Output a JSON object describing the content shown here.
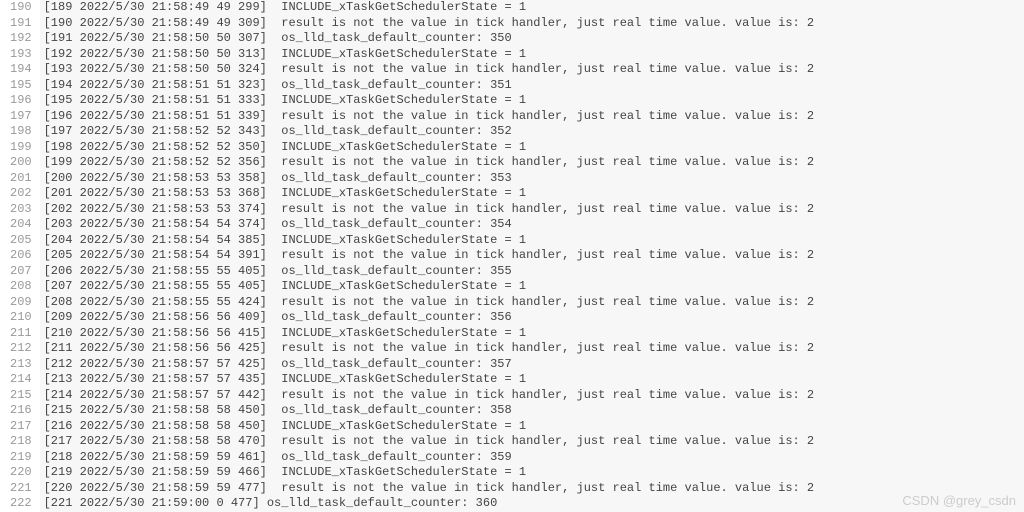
{
  "watermark": "CSDN @grey_csdn",
  "lines": [
    {
      "n": 190,
      "t": "[189 2022/5/30 21:58:49 49 299]  INCLUDE_xTaskGetSchedulerState = 1"
    },
    {
      "n": 191,
      "t": "[190 2022/5/30 21:58:49 49 309]  result is not the value in tick handler, just real time value. value is: 2"
    },
    {
      "n": 192,
      "t": "[191 2022/5/30 21:58:50 50 307]  os_lld_task_default_counter: 350"
    },
    {
      "n": 193,
      "t": "[192 2022/5/30 21:58:50 50 313]  INCLUDE_xTaskGetSchedulerState = 1"
    },
    {
      "n": 194,
      "t": "[193 2022/5/30 21:58:50 50 324]  result is not the value in tick handler, just real time value. value is: 2"
    },
    {
      "n": 195,
      "t": "[194 2022/5/30 21:58:51 51 323]  os_lld_task_default_counter: 351"
    },
    {
      "n": 196,
      "t": "[195 2022/5/30 21:58:51 51 333]  INCLUDE_xTaskGetSchedulerState = 1"
    },
    {
      "n": 197,
      "t": "[196 2022/5/30 21:58:51 51 339]  result is not the value in tick handler, just real time value. value is: 2"
    },
    {
      "n": 198,
      "t": "[197 2022/5/30 21:58:52 52 343]  os_lld_task_default_counter: 352"
    },
    {
      "n": 199,
      "t": "[198 2022/5/30 21:58:52 52 350]  INCLUDE_xTaskGetSchedulerState = 1"
    },
    {
      "n": 200,
      "t": "[199 2022/5/30 21:58:52 52 356]  result is not the value in tick handler, just real time value. value is: 2"
    },
    {
      "n": 201,
      "t": "[200 2022/5/30 21:58:53 53 358]  os_lld_task_default_counter: 353"
    },
    {
      "n": 202,
      "t": "[201 2022/5/30 21:58:53 53 368]  INCLUDE_xTaskGetSchedulerState = 1"
    },
    {
      "n": 203,
      "t": "[202 2022/5/30 21:58:53 53 374]  result is not the value in tick handler, just real time value. value is: 2"
    },
    {
      "n": 204,
      "t": "[203 2022/5/30 21:58:54 54 374]  os_lld_task_default_counter: 354"
    },
    {
      "n": 205,
      "t": "[204 2022/5/30 21:58:54 54 385]  INCLUDE_xTaskGetSchedulerState = 1"
    },
    {
      "n": 206,
      "t": "[205 2022/5/30 21:58:54 54 391]  result is not the value in tick handler, just real time value. value is: 2"
    },
    {
      "n": 207,
      "t": "[206 2022/5/30 21:58:55 55 405]  os_lld_task_default_counter: 355"
    },
    {
      "n": 208,
      "t": "[207 2022/5/30 21:58:55 55 405]  INCLUDE_xTaskGetSchedulerState = 1"
    },
    {
      "n": 209,
      "t": "[208 2022/5/30 21:58:55 55 424]  result is not the value in tick handler, just real time value. value is: 2"
    },
    {
      "n": 210,
      "t": "[209 2022/5/30 21:58:56 56 409]  os_lld_task_default_counter: 356"
    },
    {
      "n": 211,
      "t": "[210 2022/5/30 21:58:56 56 415]  INCLUDE_xTaskGetSchedulerState = 1"
    },
    {
      "n": 212,
      "t": "[211 2022/5/30 21:58:56 56 425]  result is not the value in tick handler, just real time value. value is: 2"
    },
    {
      "n": 213,
      "t": "[212 2022/5/30 21:58:57 57 425]  os_lld_task_default_counter: 357"
    },
    {
      "n": 214,
      "t": "[213 2022/5/30 21:58:57 57 435]  INCLUDE_xTaskGetSchedulerState = 1"
    },
    {
      "n": 215,
      "t": "[214 2022/5/30 21:58:57 57 442]  result is not the value in tick handler, just real time value. value is: 2"
    },
    {
      "n": 216,
      "t": "[215 2022/5/30 21:58:58 58 450]  os_lld_task_default_counter: 358"
    },
    {
      "n": 217,
      "t": "[216 2022/5/30 21:58:58 58 450]  INCLUDE_xTaskGetSchedulerState = 1"
    },
    {
      "n": 218,
      "t": "[217 2022/5/30 21:58:58 58 470]  result is not the value in tick handler, just real time value. value is: 2"
    },
    {
      "n": 219,
      "t": "[218 2022/5/30 21:58:59 59 461]  os_lld_task_default_counter: 359"
    },
    {
      "n": 220,
      "t": "[219 2022/5/30 21:58:59 59 466]  INCLUDE_xTaskGetSchedulerState = 1"
    },
    {
      "n": 221,
      "t": "[220 2022/5/30 21:58:59 59 477]  result is not the value in tick handler, just real time value. value is: 2"
    },
    {
      "n": 222,
      "t": "[221 2022/5/30 21:59:00 0 477] os_lld_task_default_counter: 360"
    }
  ]
}
